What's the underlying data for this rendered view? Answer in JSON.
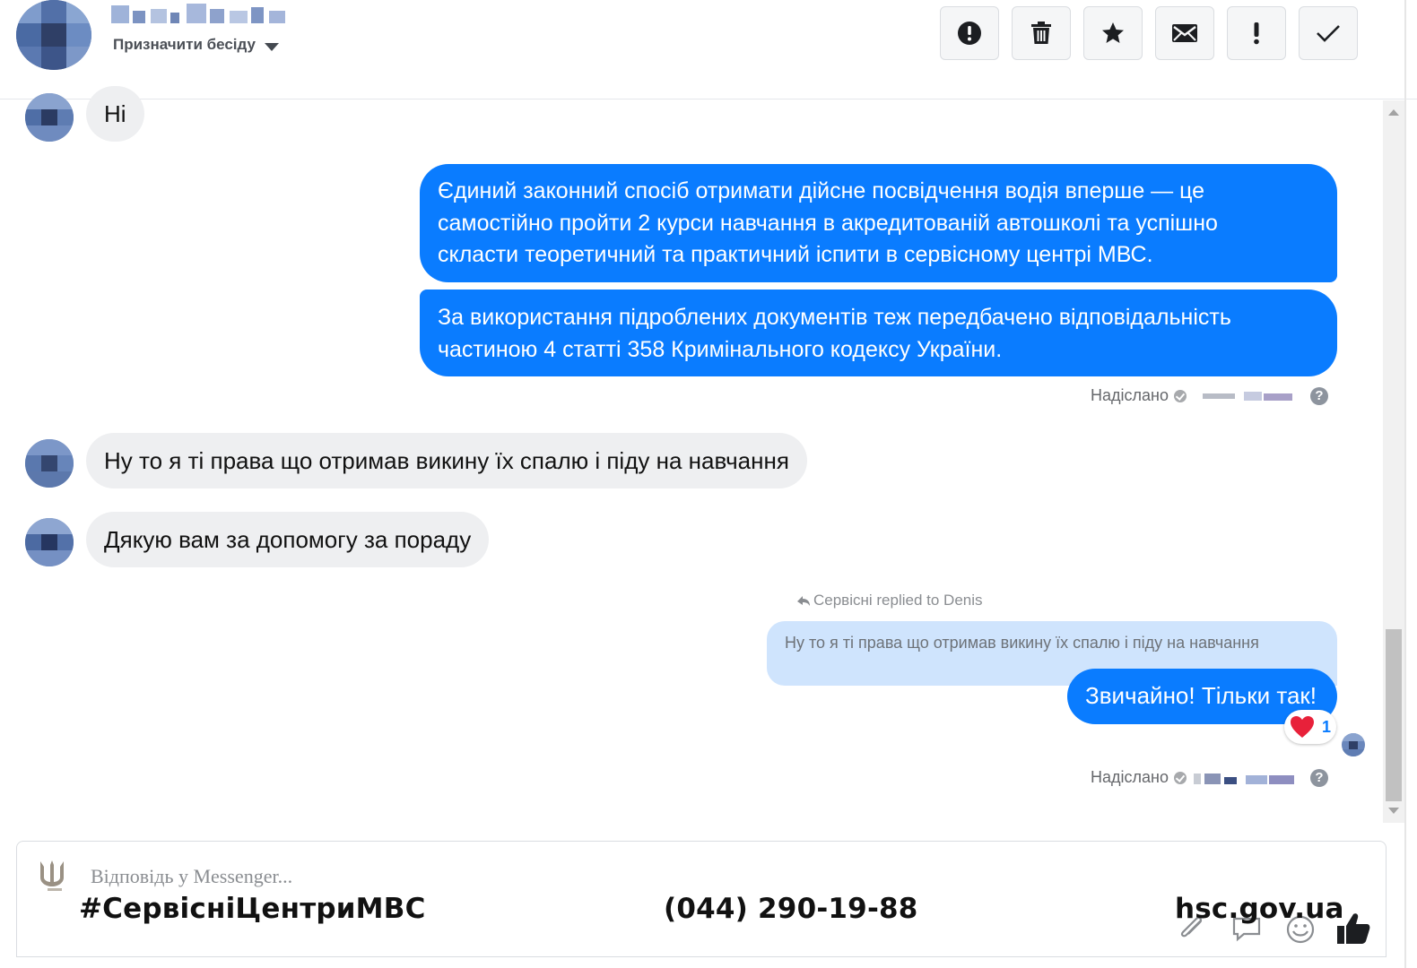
{
  "header": {
    "assign_label": "Призначити бесіду",
    "toolbar": [
      {
        "name": "spam-button",
        "icon": "alert-circle-icon"
      },
      {
        "name": "delete-button",
        "icon": "trash-icon"
      },
      {
        "name": "star-button",
        "icon": "star-icon"
      },
      {
        "name": "mark-unread-button",
        "icon": "envelope-icon"
      },
      {
        "name": "important-button",
        "icon": "exclamation-icon"
      },
      {
        "name": "done-button",
        "icon": "checkmark-icon"
      }
    ]
  },
  "messages": {
    "in_1": "Ні",
    "out_1": [
      "Єдиний законний спосіб отримати дійсне посвідчення водія вперше — це",
      "самостійно пройти 2 курси навчання в акредитованій автошколі та успішно",
      "скласти теоретичний та практичний іспити в сервісному центрі МВС."
    ],
    "out_2": [
      "За використання підроблених документів теж передбачено відповідальність",
      "частиною 4 статті 358 Кримінального кодексу України."
    ],
    "sent_label": "Надіслано",
    "help_glyph": "?",
    "in_2": "Ну то я ті права що отримав викину їх спалю і піду на навчання",
    "in_3": "Дякую вам за допомогу за пораду",
    "replied_label": "Сервісні replied to Denis",
    "quoted_text": "Ну то я ті права що отримав викину їх спалю і піду на навчання",
    "out_3": "Звичайно! Тільки так!",
    "reaction_count": "1"
  },
  "composer": {
    "placeholder": "Відповідь у Messenger..."
  },
  "footer": {
    "hashtag": "#СервісніЦентриМВС",
    "phone": "(044) 290-19-88",
    "site": "hsc.gov.ua"
  },
  "colors": {
    "outgoing_bubble": "#0a7cff",
    "incoming_bubble": "#eeeff1",
    "quote_bubble": "#cfe4fd"
  }
}
